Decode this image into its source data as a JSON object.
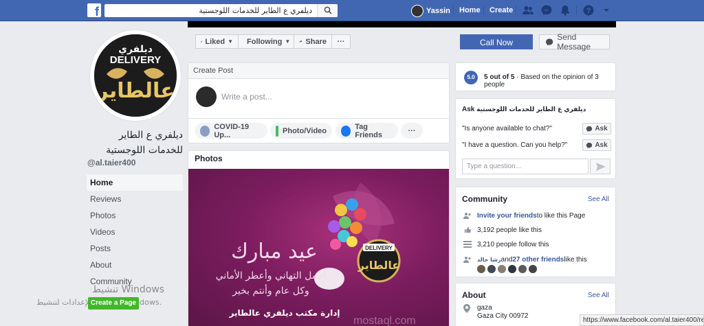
{
  "topbar": {
    "search_value": "ديلفري ع الطاير للخدمات اللوجستية",
    "user_name": "Yassin",
    "home_label": "Home",
    "create_label": "Create",
    "brand_color": "#4267b2"
  },
  "page": {
    "name": "ديلفري ع الطاير للخدمات اللوجستية",
    "handle": "@al.taier400",
    "logo_text": "ديلفري DELIVERY عالطاير"
  },
  "left_nav": {
    "items": [
      {
        "label": "Home",
        "active": true
      },
      {
        "label": "Reviews"
      },
      {
        "label": "Photos"
      },
      {
        "label": "Videos"
      },
      {
        "label": "Posts"
      },
      {
        "label": "About"
      },
      {
        "label": "Community"
      }
    ],
    "create_page_label": "Create a Page",
    "windows_watermark": "تنشيط Windows",
    "windows_watermark2": "انتقل إلى الإعدادات لتنشيط Windows."
  },
  "actions": {
    "liked": "Liked",
    "following": "Following",
    "share": "Share",
    "more": "···",
    "call_now": "Call Now",
    "send_message": "Send Message"
  },
  "create_post": {
    "title": "Create Post",
    "placeholder": "Write a post...",
    "covid": "COVID-19 Up...",
    "photo_video": "Photo/Video",
    "tag_friends": "Tag Friends",
    "more": "···"
  },
  "photos": {
    "title": "Photos",
    "eid_text": "عيد مبارك",
    "wish_line1": "أجمل التهاني وأعطر الأماني",
    "wish_line2": "وكل عام وأنتم بخير",
    "footer_text": "إدارة مكتب ديلفري عالطاير",
    "watermark": "mostaql.com"
  },
  "rating": {
    "score": "5.0",
    "text_bold": "5 out of 5",
    "text_rest": " · Based on the opinion of 3 people"
  },
  "ask": {
    "title_prefix": "Ask",
    "title_name": "ديلفري ع الطاير للخدمات اللوجستية",
    "q1": "\"Is anyone available to chat?\"",
    "q2": "\"I have a question. Can you help?\"",
    "ask_label": "Ask",
    "input_placeholder": "Type a question..."
  },
  "community": {
    "title": "Community",
    "see_all": "See All",
    "invite_link": "Invite your friends",
    "invite_rest": " to like this Page",
    "likes": "3,192 people like this",
    "follows": "3,210 people follow this",
    "friend_name": "رشا خالد",
    "friends_mid": " and ",
    "other_friends": "27 other friends",
    "friends_end": " like this"
  },
  "about": {
    "title": "About",
    "see_all": "See All",
    "addr1": "gaza",
    "addr2": "Gaza City 00972"
  },
  "statusbar": {
    "url": "https://www.facebook.com/al.taier400/reviews"
  }
}
